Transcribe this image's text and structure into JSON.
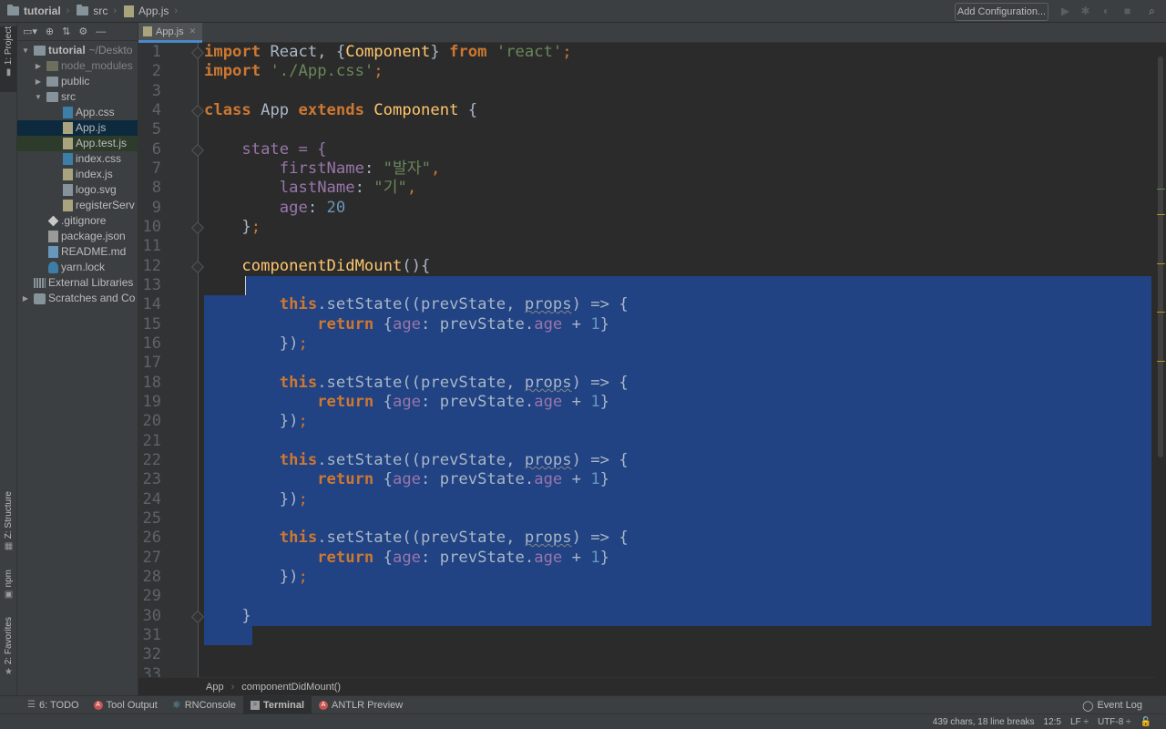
{
  "navbar": {
    "project": "tutorial",
    "folder": "src",
    "file": "App.js",
    "add_config": "Add Configuration..."
  },
  "left_strip": {
    "project_tab": "1: Project",
    "structure_tab": "Z: Structure",
    "npm_tab": "npm",
    "favorites_tab": "2: Favorites"
  },
  "project_tree": {
    "root": "tutorial",
    "root_path": "~/Deskto",
    "items": [
      "node_modules",
      "public",
      "src",
      "App.css",
      "App.js",
      "App.test.js",
      "index.css",
      "index.js",
      "logo.svg",
      "registerServ",
      ".gitignore",
      "package.json",
      "README.md",
      "yarn.lock",
      "External Libraries",
      "Scratches and Co"
    ]
  },
  "editor": {
    "tab": "App.js",
    "breadcrumb_class": "App",
    "breadcrumb_method": "componentDidMount()"
  },
  "line_numbers": [
    "1",
    "2",
    "3",
    "4",
    "5",
    "6",
    "7",
    "8",
    "9",
    "10",
    "11",
    "12",
    "13",
    "14",
    "15",
    "16",
    "17",
    "18",
    "19",
    "20",
    "21",
    "22",
    "23",
    "24",
    "25",
    "26",
    "27",
    "28",
    "29",
    "30",
    "31",
    "32",
    "33"
  ],
  "code": {
    "import_kw": "import",
    "react": " React, {",
    "component": "Component",
    "close_brace": "} ",
    "from_kw": "from",
    "react_str": "'react'",
    "semi": ";",
    "css_str": "'./App.css'",
    "class_kw": "class",
    "app": " App ",
    "extends_kw": "extends",
    "open": " {",
    "state": "    state = {",
    "first_name": "firstName",
    "first_val": "\"발자\"",
    "last_name": "lastName",
    "last_val": "\"기\"",
    "age": "age",
    "age_val": "20",
    "close_state": "    }",
    "mount": "componentDidMount",
    "mount_paren": "(){",
    "this_kw": "this",
    "set_state": ".setState((prevState, ",
    "props": "props",
    ") => {": ") => {",
    "return_kw": "return",
    "obj_open": " {",
    "prev": ": prevState.",
    "plus": " + ",
    "one": "1",
    "obj_close": "}",
    "close_call": "        })",
    "end_brace": "    }"
  },
  "bottom_tools": [
    "6: TODO",
    "Tool Output",
    "RNConsole",
    "Terminal",
    "ANTLR Preview"
  ],
  "event_log": "Event Log",
  "status": {
    "chars": "439 chars, 18 line breaks",
    "pos": "12:5",
    "lf": "LF ÷",
    "enc": "UTF-8 ÷"
  },
  "colors": {
    "keyword": "#cc7832",
    "string": "#6a8759",
    "selection": "#214283",
    "property": "#9876aa",
    "number": "#6897bb"
  }
}
